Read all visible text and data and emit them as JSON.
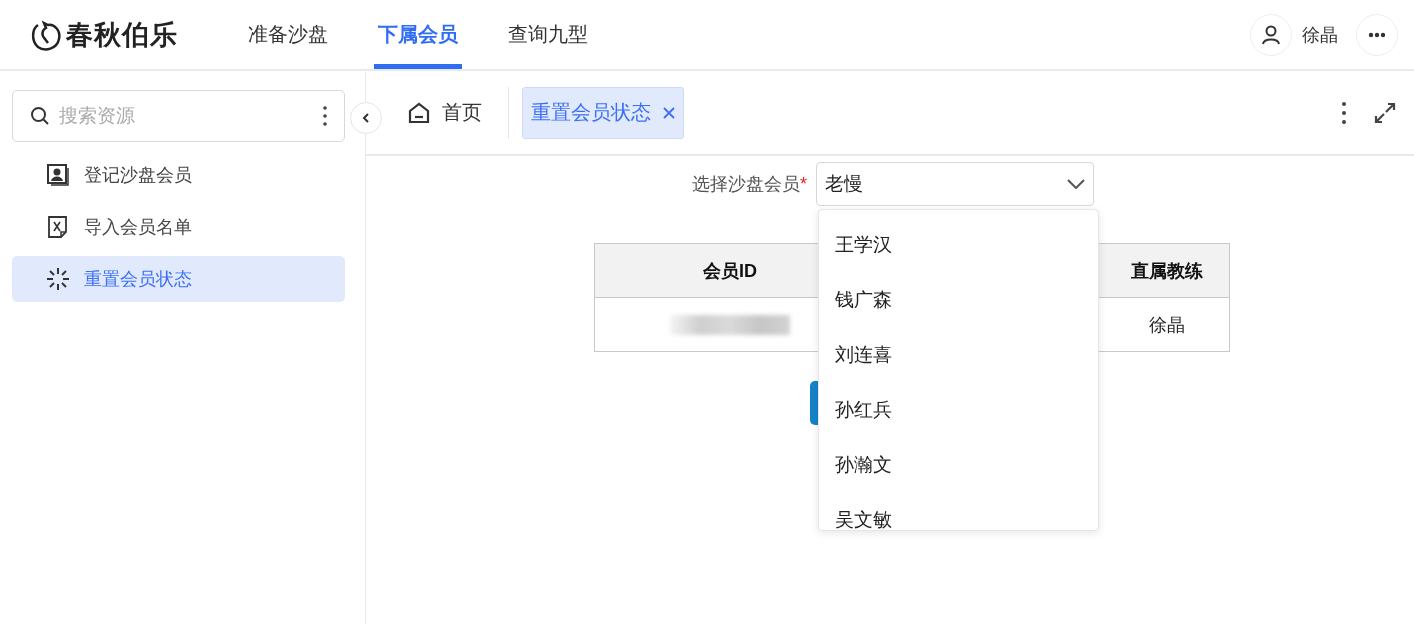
{
  "header": {
    "logo": "春秋伯乐",
    "nav": [
      {
        "label": "准备沙盘",
        "selected": false
      },
      {
        "label": "下属会员",
        "selected": true
      },
      {
        "label": "查询九型",
        "selected": false
      }
    ],
    "user": {
      "name": "徐晶"
    }
  },
  "sidebar": {
    "search": {
      "placeholder": "搜索资源"
    },
    "items": [
      {
        "label": "登记沙盘会员",
        "kind": "contact",
        "selected": false
      },
      {
        "label": "导入会员名单",
        "kind": "excel",
        "selected": false
      },
      {
        "label": "重置会员状态",
        "kind": "loading",
        "selected": true
      }
    ]
  },
  "tabs": [
    {
      "label": "首页",
      "kind": "home",
      "selected": false
    },
    {
      "label": "重置会员状态",
      "kind": "closable",
      "selected": true
    }
  ],
  "form": {
    "label": "选择沙盘会员",
    "required_mark": "*",
    "value": "老慢",
    "dropdown": {
      "expanded": true,
      "options": [
        "王学汉",
        "钱广森",
        "刘连喜",
        "孙红兵",
        "孙瀚文",
        "吴文敏"
      ]
    }
  },
  "table": {
    "columns": [
      "会员ID",
      "直属教练"
    ],
    "rows": [
      {
        "cells": [
          {
            "kind": "redacted"
          },
          {
            "kind": "text",
            "text": "徐晶"
          }
        ]
      }
    ]
  }
}
